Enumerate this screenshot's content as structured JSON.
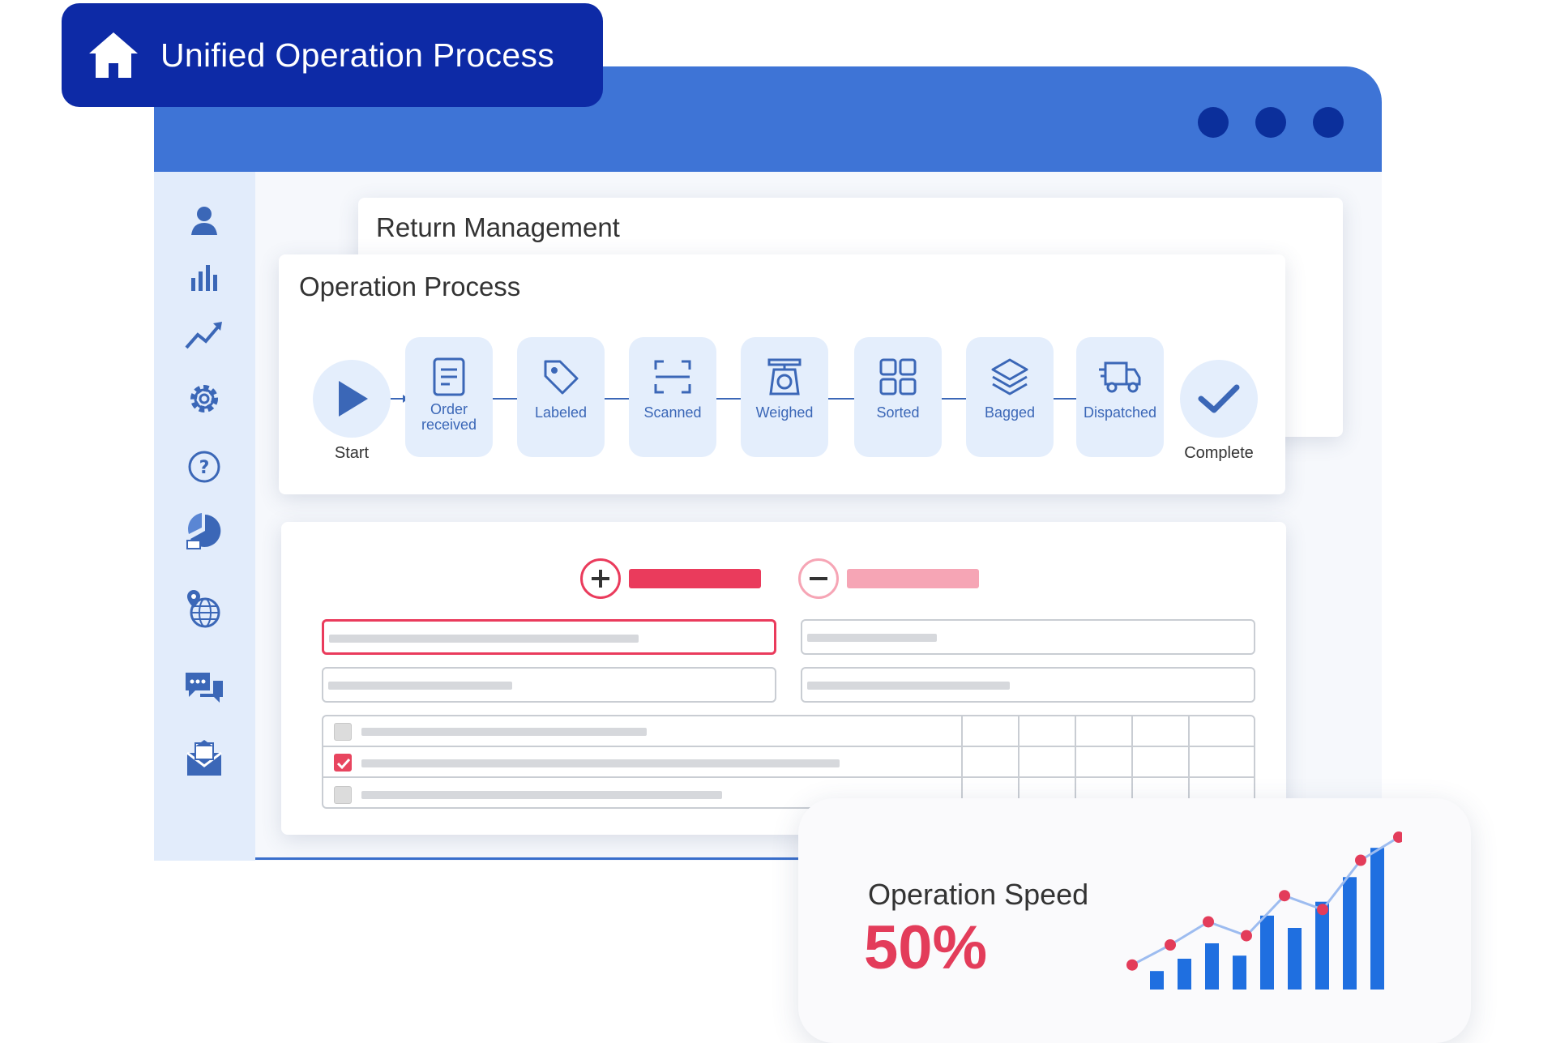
{
  "header": {
    "title": "Unified Operation Process",
    "icon": "home-icon"
  },
  "window": {
    "titlebar_color": "#3e74d6",
    "controls": [
      "window-dot",
      "window-dot",
      "window-dot"
    ]
  },
  "sidebar": {
    "icons": [
      "user-icon",
      "bar-chart-icon",
      "trend-line-icon",
      "gear-icon",
      "help-icon",
      "pie-chart-icon",
      "globe-location-icon",
      "chat-icon",
      "mail-icon"
    ]
  },
  "return_panel": {
    "title": "Return Management"
  },
  "process_panel": {
    "title": "Operation Process",
    "start_label": "Start",
    "complete_label": "Complete",
    "steps": [
      {
        "label": "Order received",
        "icon": "document-icon"
      },
      {
        "label": "Labeled",
        "icon": "tag-icon"
      },
      {
        "label": "Scanned",
        "icon": "scan-frame-icon"
      },
      {
        "label": "Weighed",
        "icon": "scale-icon"
      },
      {
        "label": "Sorted",
        "icon": "grid-icon"
      },
      {
        "label": "Bagged",
        "icon": "layers-icon"
      },
      {
        "label": "Dispatched",
        "icon": "truck-icon"
      }
    ]
  },
  "form_panel": {
    "add_icon": "plus-icon",
    "remove_icon": "minus-icon",
    "accent_color": "#ea3b5c",
    "accent_light_color": "#f6a5b5",
    "table_rows": [
      {
        "checked": false
      },
      {
        "checked": true
      },
      {
        "checked": false
      }
    ]
  },
  "speed_card": {
    "title": "Operation Speed",
    "value": "50%"
  },
  "chart_data": {
    "type": "bar",
    "title": "",
    "xlabel": "",
    "ylabel": "",
    "ylim": [
      0,
      100
    ],
    "grid": false,
    "values": [
      12,
      20,
      30,
      22,
      48,
      40,
      57,
      73,
      92
    ],
    "line_values": [
      17,
      30,
      45,
      36,
      62,
      53,
      85,
      100
    ],
    "bar_color": "#1f6fe0",
    "line_color": "#9dbcf0",
    "marker_color": "#e33c5a"
  }
}
